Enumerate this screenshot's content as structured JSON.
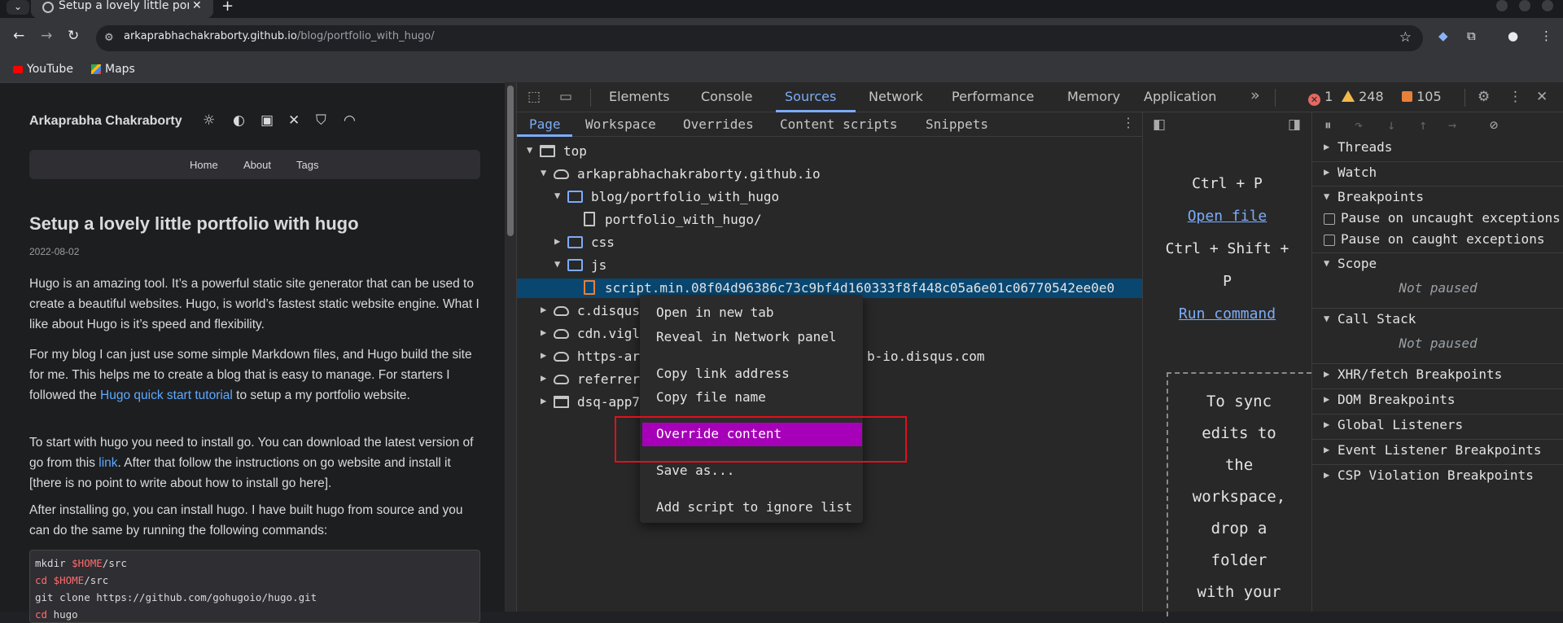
{
  "browser": {
    "tab_title": "Setup a lovely little portfolio with hugo",
    "url_host": "arkaprabhachakraborty.github.io",
    "url_path": "/blog/portfolio_with_hugo/",
    "bookmarks": [
      {
        "label": "YouTube"
      },
      {
        "label": "Maps"
      }
    ]
  },
  "blog": {
    "author": "Arkaprabha Chakraborty",
    "menu": [
      "Home",
      "About",
      "Tags"
    ],
    "title": "Setup a lovely little portfolio with hugo",
    "date": "2022-08-02",
    "p1": "Hugo is an amazing tool. It’s a powerful static site generator that can be used to create a beautiful websites. Hugo, is world’s fastest static website engine. What I like about Hugo is it’s speed and flexibility.",
    "p2_before": "For my blog I can just use some simple Markdown files, and Hugo build the site for me. This helps me to create a blog that is easy to manage. For starters I followed the ",
    "p2_link": "Hugo quick start tutorial",
    "p2_after": " to setup a my portfolio website.",
    "p3_before": "To start with hugo you need to install go. You can download the latest version of go from this ",
    "p3_link": "link",
    "p3_after": ". After that follow the instructions on go website and install it [there is no point to write about how to install go here].",
    "p4": "After installing go, you can install hugo. I have built hugo from source and you can do the same by running the following commands:",
    "code": {
      "l1_cmd": "mkdir ",
      "l1_var": "$HOME",
      "l1_rest": "/src",
      "l2_cmd": "cd ",
      "l2_var": "$HOME",
      "l2_rest": "/src",
      "l3": "git clone https://github.com/gohugoio/hugo.git",
      "l4_cmd": "cd",
      "l4_rest": " hugo"
    }
  },
  "devtools": {
    "tabs": [
      "Elements",
      "Console",
      "Sources",
      "Network",
      "Performance",
      "Memory",
      "Application"
    ],
    "active_tab": "Sources",
    "errors": "1",
    "warnings": "248",
    "issues": "105",
    "nav_tabs": [
      "Page",
      "Workspace",
      "Overrides",
      "Content scripts",
      "Snippets"
    ],
    "tree": {
      "top": "top",
      "origin": "arkaprabhachakraborty.github.io",
      "blog_folder": "blog/portfolio_with_hugo",
      "blog_file": "portfolio_with_hugo/",
      "css": "css",
      "js": "js",
      "script": "script.min.08f04d96386c73c9bf4d160333f8f448c05a6e01c06770542ee0e0",
      "disqus": "c.disqus.com",
      "viglink": "cdn.viglink.com",
      "https_prefix": "https-ar",
      "https_suffix": "b-io.disqus.com",
      "referrer": "referrer",
      "dsq": "dsq-app7"
    },
    "editor": {
      "shortcut1": "Ctrl + P",
      "open_file": "Open file",
      "shortcut2_a": "Ctrl + Shift +",
      "shortcut2_b": "P",
      "run_command": "Run command",
      "drop_lines": [
        "To sync",
        "edits to",
        "the",
        "workspace,",
        "drop a",
        "folder",
        "with your"
      ]
    },
    "debugger": {
      "threads": "Threads",
      "watch": "Watch",
      "breakpoints": "Breakpoints",
      "pause_uncaught": "Pause on uncaught exceptions",
      "pause_caught": "Pause on caught exceptions",
      "scope": "Scope",
      "not_paused_1": "Not paused",
      "call_stack": "Call Stack",
      "not_paused_2": "Not paused",
      "xhr": "XHR/fetch Breakpoints",
      "dom": "DOM Breakpoints",
      "global": "Global Listeners",
      "event": "Event Listener Breakpoints",
      "csp": "CSP Violation Breakpoints"
    },
    "context_menu": [
      "Open in new tab",
      "Reveal in Network panel",
      "Copy link address",
      "Copy file name",
      "Override content",
      "Save as...",
      "Add script to ignore list"
    ],
    "highlighted_item": "Override content",
    "highlight_color": "#a600b8",
    "annotation_color": "#e0101a"
  }
}
